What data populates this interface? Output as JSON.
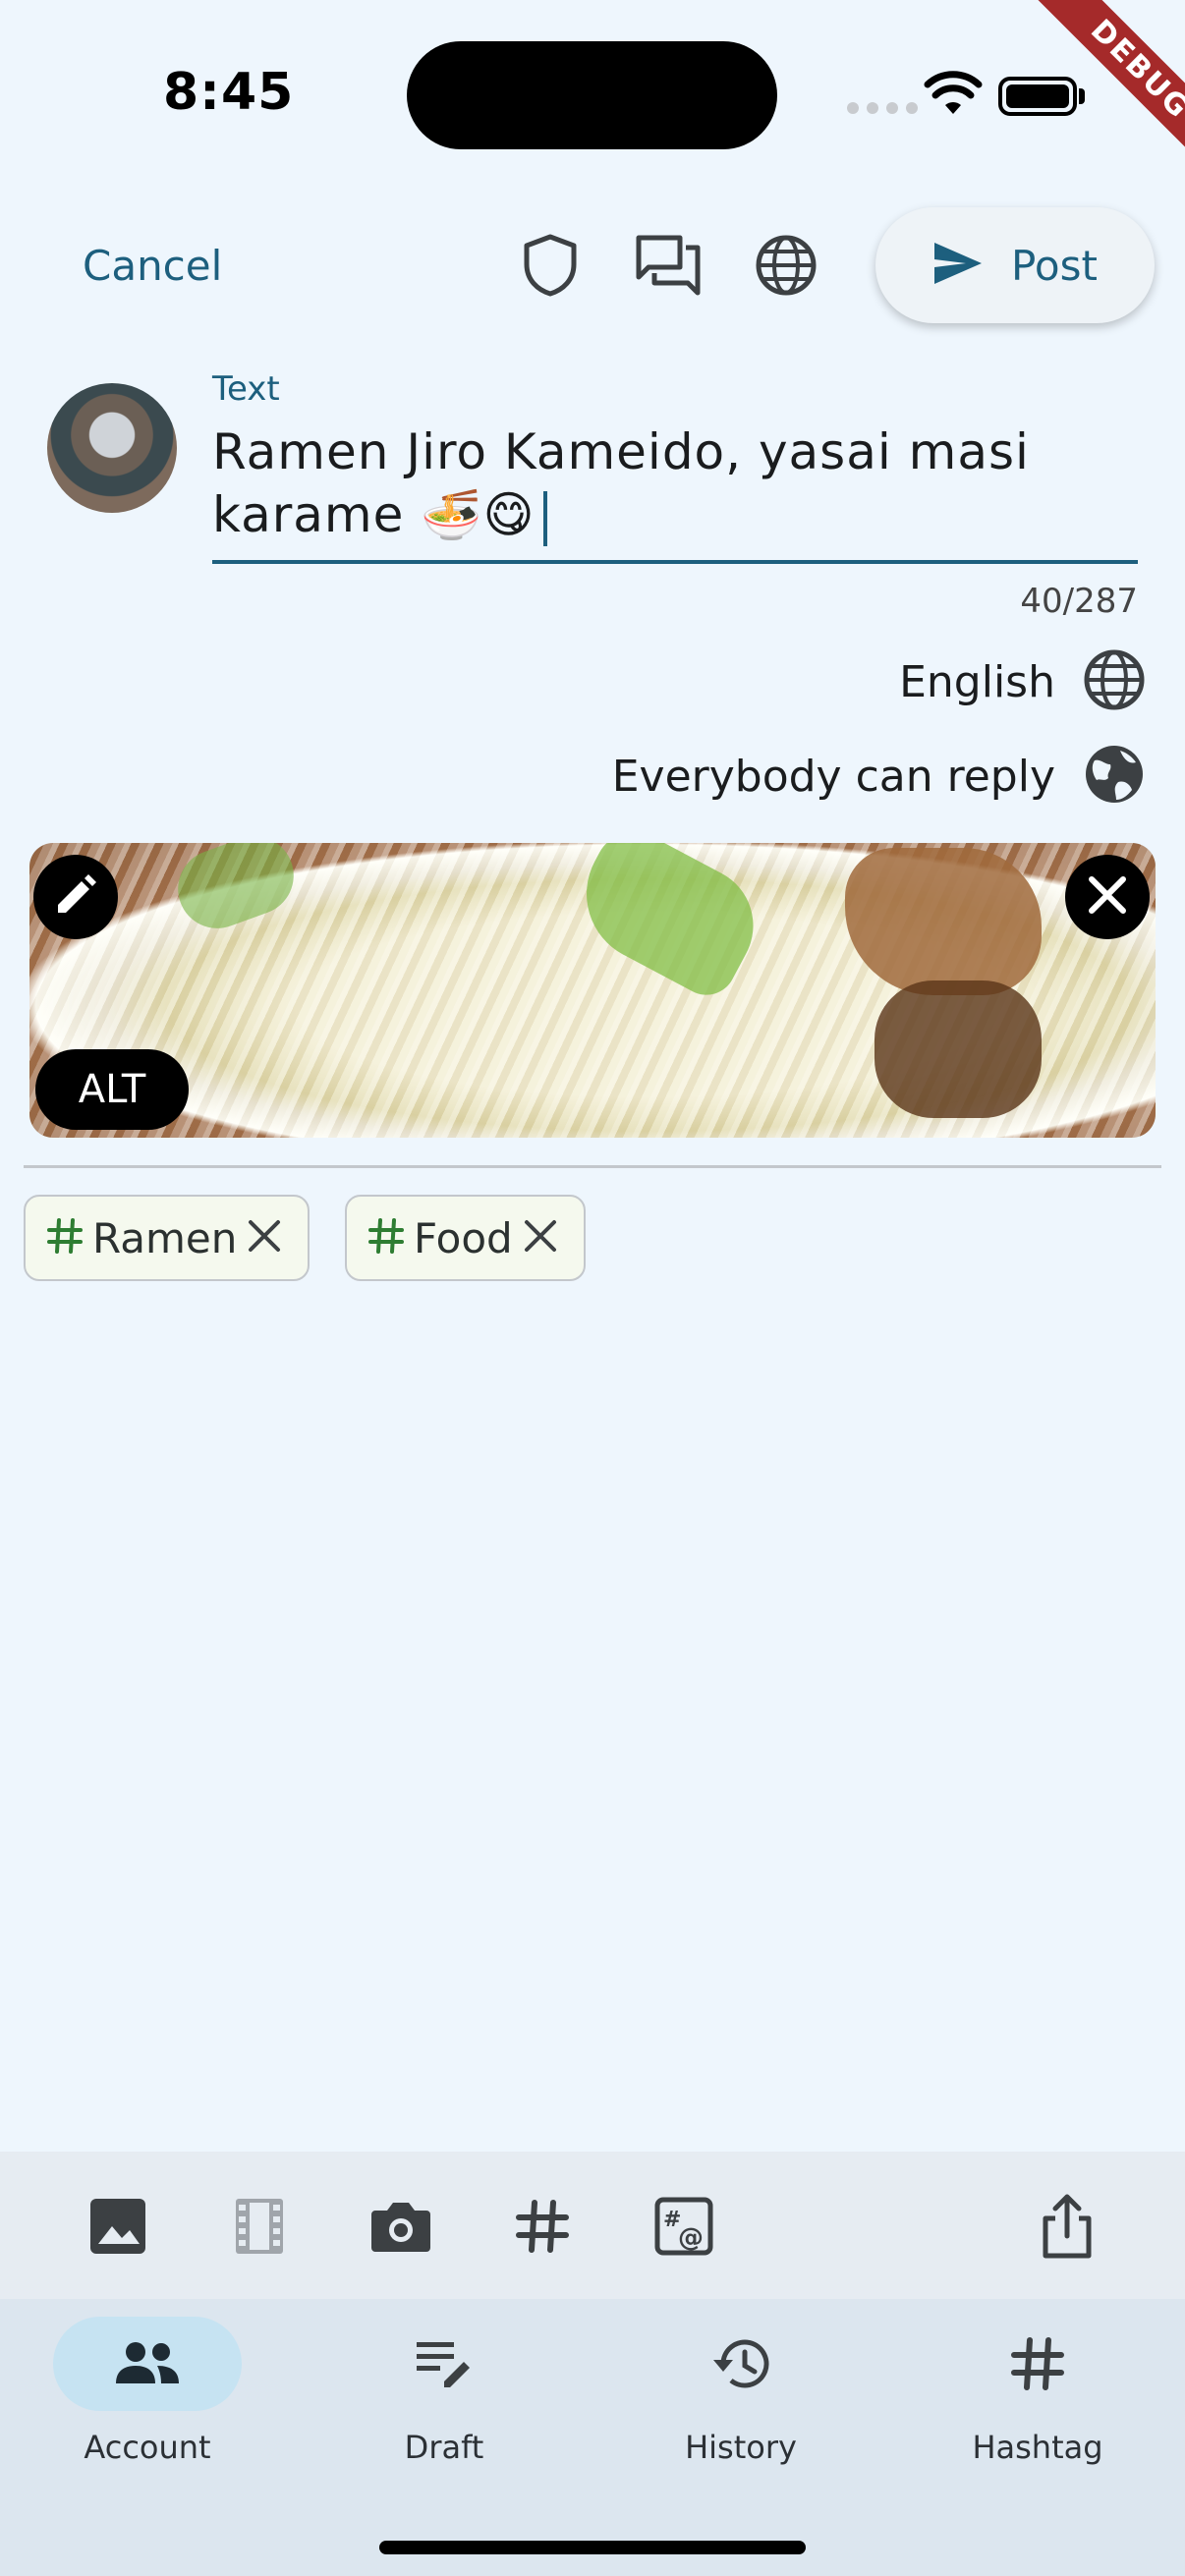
{
  "status_bar": {
    "time": "8:45",
    "debug_banner": "DEBUG"
  },
  "app_bar": {
    "cancel_label": "Cancel",
    "post_label": "Post",
    "icons": [
      "shield-icon",
      "forum-icon",
      "globe-icon",
      "send-icon"
    ]
  },
  "composer": {
    "field_label": "Text",
    "text": "Ramen Jiro Kameido, yasai masi karame 🍜😋",
    "char_count": "40/287",
    "language": "English",
    "reply_setting": "Everybody can reply",
    "accent_color": "#1d5f7e"
  },
  "media": {
    "alt_label": "ALT"
  },
  "hashtags": [
    {
      "symbol": "#",
      "label": "Ramen"
    },
    {
      "symbol": "#",
      "label": "Food"
    }
  ],
  "toolbar": {
    "icons": [
      "image-icon",
      "video-icon",
      "camera-icon",
      "hashtag-icon",
      "mention-hashtag-icon",
      "share-icon"
    ]
  },
  "nav": {
    "items": [
      {
        "label": "Account",
        "icon": "people-icon",
        "active": true
      },
      {
        "label": "Draft",
        "icon": "draft-icon",
        "active": false
      },
      {
        "label": "History",
        "icon": "history-icon",
        "active": false
      },
      {
        "label": "Hashtag",
        "icon": "hashtag-icon",
        "active": false
      }
    ]
  }
}
